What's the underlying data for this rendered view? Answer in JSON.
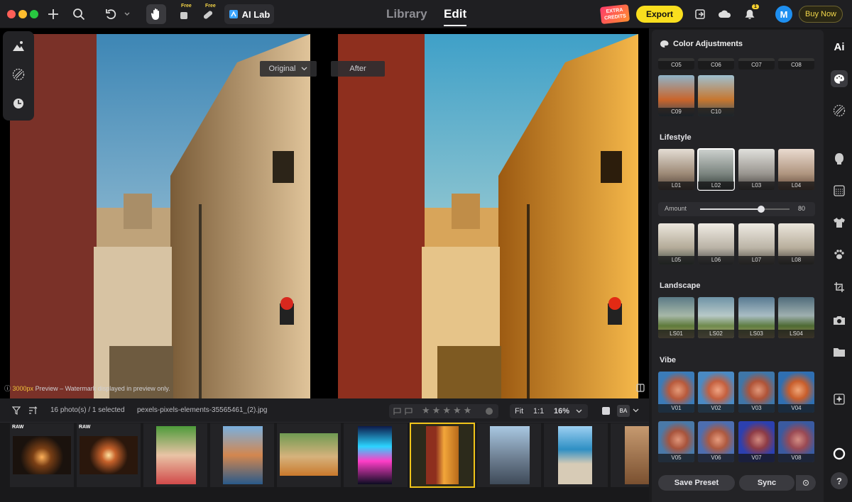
{
  "topbar": {
    "ai_lab_label": "AI Lab",
    "free_label": "Free",
    "tabs": [
      "Library",
      "Edit"
    ],
    "active_tab": "Edit",
    "credits_line1": "EXTRA",
    "credits_line2": "CREDITS",
    "export_label": "Export",
    "notification_count": "1",
    "avatar_initial": "M",
    "buy_now_label": "Buy Now"
  },
  "viewer": {
    "before_label": "Original",
    "after_label": "After",
    "watermark_size": "3000px",
    "watermark_text": " Preview – Watermark displayed in preview only."
  },
  "filmstrip": {
    "photo_count": "16 photo(s) / 1 selected",
    "filename": "pexels-pixels-elements-35565461_(2).jpg",
    "fit_label": "Fit",
    "ratio_label": "1:1",
    "zoom": "16%",
    "ba_label": "BA",
    "rating": 0,
    "raw_label": "RAW",
    "thumbnails": [
      "tunnel",
      "tunnel",
      "child",
      "harbor",
      "puppies",
      "neon",
      "street",
      "city",
      "beach",
      "partial"
    ],
    "selected_index": 6
  },
  "panel": {
    "title": "Color Adjustments",
    "cinematic": [
      "C05",
      "C06",
      "C07",
      "C08",
      "C09",
      "C10"
    ],
    "lifestyle_title": "Lifestyle",
    "lifestyle": [
      "L01",
      "L02",
      "L03",
      "L04",
      "L05",
      "L06",
      "L07",
      "L08"
    ],
    "lifestyle_selected": "L02",
    "amount_label": "Amount",
    "amount_value": "80",
    "landscape_title": "Landscape",
    "landscape": [
      "LS01",
      "LS02",
      "LS03",
      "LS04"
    ],
    "vibe_title": "Vibe",
    "vibe": [
      "V01",
      "V02",
      "V03",
      "V04",
      "V05",
      "V06",
      "V07",
      "V08"
    ],
    "save_preset_label": "Save Preset",
    "sync_label": "Sync"
  },
  "rail": {
    "ai_label": "Ai",
    "help_label": "?"
  },
  "icons": [
    "add-icon",
    "search-icon",
    "undo-icon",
    "hand-icon",
    "eraser-icon",
    "bandage-icon",
    "sign-in-icon",
    "cloud-icon",
    "bell-icon",
    "mountain-icon",
    "texture-icon",
    "history-icon",
    "filter-icon",
    "sort-icon",
    "flag-icon",
    "star-icon",
    "palette-icon",
    "face-icon",
    "shirt-icon",
    "paw-icon",
    "crop-icon",
    "camera-icon",
    "folder-icon",
    "sparkle-icon"
  ],
  "colors": {
    "accent": "#f9de1e",
    "selection": "#f0c419",
    "avatar": "#1e8ff0"
  }
}
